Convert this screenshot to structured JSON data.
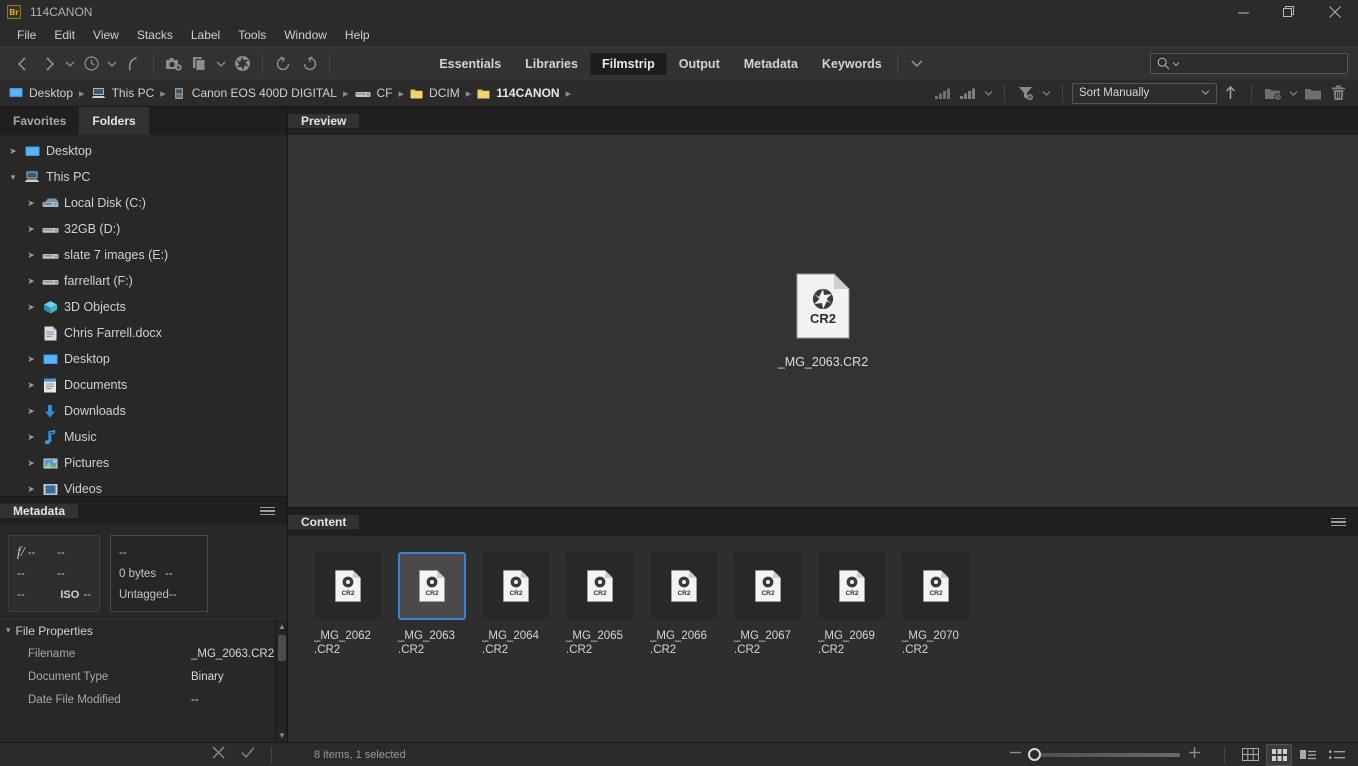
{
  "window": {
    "title": "114CANON",
    "logo_text": "Br",
    "controls": {
      "minimize": "minimize",
      "maximize": "restore",
      "close": "close"
    }
  },
  "menubar": {
    "items": [
      "File",
      "Edit",
      "View",
      "Stacks",
      "Label",
      "Tools",
      "Window",
      "Help"
    ]
  },
  "toolbar": {
    "nav_back": "back-icon",
    "nav_forward": "forward-icon",
    "recent_dropdown": "chevron-down-icon",
    "history": "history-icon",
    "history_dropdown": "chevron-down-icon",
    "boomerang": "return-recent-icon",
    "camera_raw": "get-photos-from-camera-icon",
    "refine": "refine-icon",
    "refine_dropdown": "chevron-down-icon",
    "open_in_camera_raw": "aperture-icon",
    "rotate_ccw": "rotate-counterclockwise-icon",
    "rotate_cw": "rotate-clockwise-icon",
    "workspaces": [
      {
        "label": "Essentials",
        "active": false
      },
      {
        "label": "Libraries",
        "active": false
      },
      {
        "label": "Filmstrip",
        "active": true
      },
      {
        "label": "Output",
        "active": false
      },
      {
        "label": "Metadata",
        "active": false
      },
      {
        "label": "Keywords",
        "active": false
      }
    ],
    "workspace_more": "chevron-down-icon",
    "search": {
      "value": "",
      "placeholder": "",
      "icon": "search-icon"
    }
  },
  "pathbar": {
    "crumbs": [
      {
        "label": "Desktop",
        "icon": "desktop-icon",
        "current": false
      },
      {
        "label": "This PC",
        "icon": "this-pc-icon",
        "current": false
      },
      {
        "label": "Canon EOS 400D DIGITAL",
        "icon": "camera-icon",
        "current": false
      },
      {
        "label": "CF",
        "icon": "drive-icon",
        "current": false
      },
      {
        "label": "DCIM",
        "icon": "folder-icon",
        "current": false
      },
      {
        "label": "114CANON",
        "icon": "folder-icon",
        "current": true
      }
    ],
    "tools": {
      "filter_rating": "rating-filter-icon",
      "filter_rating_dropdown": "chevron-down-icon",
      "filter_items": "filter-icon",
      "filter_items_dropdown": "chevron-down-icon",
      "sort_value": "Sort Manually",
      "sort_dropdown": "chevron-down-icon",
      "sort_direction": "ascending-arrow-icon",
      "new_subfolder": "new-folder-with-clock-icon",
      "new_subfolder_dropdown": "chevron-down-icon",
      "new_folder": "new-folder-icon",
      "delete": "trash-icon"
    }
  },
  "sidebar": {
    "tabs": [
      {
        "label": "Favorites",
        "active": false
      },
      {
        "label": "Folders",
        "active": true
      }
    ],
    "tree": [
      {
        "label": "Desktop",
        "icon": "desktop-icon",
        "indent": 0,
        "twisty": "collapsed"
      },
      {
        "label": "This PC",
        "icon": "this-pc-icon",
        "indent": 0,
        "twisty": "expanded"
      },
      {
        "label": "Local Disk (C:)",
        "icon": "hard-drive-icon",
        "indent": 1,
        "twisty": "collapsed"
      },
      {
        "label": "32GB (D:)",
        "icon": "removable-drive-icon",
        "indent": 1,
        "twisty": "collapsed"
      },
      {
        "label": "slate 7 images (E:)",
        "icon": "removable-drive-icon",
        "indent": 1,
        "twisty": "collapsed"
      },
      {
        "label": "farrellart (F:)",
        "icon": "removable-drive-icon",
        "indent": 1,
        "twisty": "collapsed"
      },
      {
        "label": "3D Objects",
        "icon": "3d-objects-icon",
        "indent": 1,
        "twisty": "collapsed"
      },
      {
        "label": "Chris Farrell.docx",
        "icon": "document-icon",
        "indent": 1,
        "twisty": "none"
      },
      {
        "label": "Desktop",
        "icon": "desktop-icon",
        "indent": 1,
        "twisty": "collapsed"
      },
      {
        "label": "Documents",
        "icon": "documents-icon",
        "indent": 1,
        "twisty": "collapsed"
      },
      {
        "label": "Downloads",
        "icon": "downloads-icon",
        "indent": 1,
        "twisty": "collapsed"
      },
      {
        "label": "Music",
        "icon": "music-icon",
        "indent": 1,
        "twisty": "collapsed"
      },
      {
        "label": "Pictures",
        "icon": "pictures-icon",
        "indent": 1,
        "twisty": "collapsed"
      },
      {
        "label": "Videos",
        "icon": "videos-icon",
        "indent": 1,
        "twisty": "collapsed"
      }
    ]
  },
  "metadata_panel": {
    "tab_label": "Metadata",
    "menu_icon": "panel-menu-icon",
    "camera_box": {
      "aperture_symbol": "f/",
      "aperture": "--",
      "shutter": "--",
      "r2c1": "--",
      "r2c2": "--",
      "r3c1": "--",
      "iso_label": "ISO",
      "iso": "--"
    },
    "file_box": {
      "colorprofile_top": "--",
      "filesize": "0 bytes",
      "dimensions": "--",
      "tagged": "Untagged",
      "resolution": "--"
    },
    "sections": [
      {
        "title": "File Properties",
        "expanded": true,
        "rows": [
          {
            "key": "Filename",
            "value": "_MG_2063.CR2"
          },
          {
            "key": "Document Type",
            "value": "Binary"
          },
          {
            "key": "Date File Modified",
            "value": "--"
          }
        ]
      }
    ]
  },
  "preview_panel": {
    "tab_label": "Preview",
    "file": {
      "name": "_MG_2063.CR2",
      "badge": "CR2",
      "icon": "cr2-file-icon"
    }
  },
  "content_panel": {
    "tab_label": "Content",
    "menu_icon": "panel-menu-icon",
    "items": [
      {
        "name": "_MG_2062",
        "ext": ".CR2",
        "badge": "CR2",
        "selected": false
      },
      {
        "name": "_MG_2063",
        "ext": ".CR2",
        "badge": "CR2",
        "selected": true
      },
      {
        "name": "_MG_2064",
        "ext": ".CR2",
        "badge": "CR2",
        "selected": false
      },
      {
        "name": "_MG_2065",
        "ext": ".CR2",
        "badge": "CR2",
        "selected": false
      },
      {
        "name": "_MG_2066",
        "ext": ".CR2",
        "badge": "CR2",
        "selected": false
      },
      {
        "name": "_MG_2067",
        "ext": ".CR2",
        "badge": "CR2",
        "selected": false
      },
      {
        "name": "_MG_2069",
        "ext": ".CR2",
        "badge": "CR2",
        "selected": false
      },
      {
        "name": "_MG_2070",
        "ext": ".CR2",
        "badge": "CR2",
        "selected": false
      }
    ]
  },
  "statusbar": {
    "cancel_icon": "close-icon",
    "confirm_icon": "check-icon",
    "status_text": "8 items, 1 selected",
    "zoom_out_icon": "minus-icon",
    "zoom_in_icon": "plus-icon",
    "zoom_value": 0,
    "view_modes": [
      {
        "icon": "grid-lock-icon",
        "active": false
      },
      {
        "icon": "thumbnail-view-icon",
        "active": true
      },
      {
        "icon": "details-view-icon",
        "active": false
      },
      {
        "icon": "list-view-icon",
        "active": false
      }
    ]
  },
  "colors": {
    "accent_selection": "#3b82d6",
    "app_background": "#1e1e1e",
    "panel_background": "#282828",
    "preview_background": "#333333",
    "logo_gold": "#d4b73c"
  }
}
